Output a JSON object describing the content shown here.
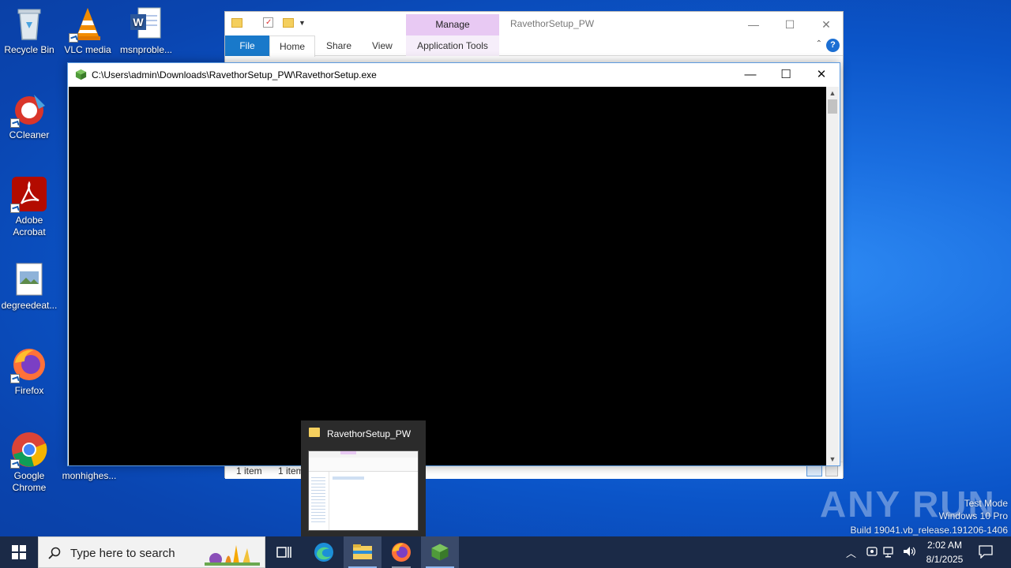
{
  "desktop": {
    "icons": [
      {
        "label": "Recycle Bin",
        "icon": "recycle-bin-icon"
      },
      {
        "label": "VLC media",
        "icon": "vlc-icon"
      },
      {
        "label": "msnproble...",
        "icon": "word-document-icon"
      },
      {
        "label": "CCleaner",
        "icon": "ccleaner-icon"
      },
      {
        "label": "Adobe Acrobat",
        "icon": "acrobat-icon"
      },
      {
        "label": "degreedeat...",
        "icon": "image-file-icon"
      },
      {
        "label": "Firefox",
        "icon": "firefox-icon"
      },
      {
        "label": "Google Chrome",
        "icon": "chrome-icon"
      },
      {
        "label": "monhighes...",
        "icon": "file-icon"
      }
    ]
  },
  "explorer": {
    "context_tab": "Manage",
    "title": "RavethorSetup_PW",
    "tabs": {
      "file": "File",
      "home": "Home",
      "share": "Share",
      "view": "View",
      "app_tools": "Application Tools"
    },
    "status_left": "1 item",
    "status_right": "1 item"
  },
  "console": {
    "title": "C:\\Users\\admin\\Downloads\\RavethorSetup_PW\\RavethorSetup.exe"
  },
  "preview": {
    "title": "RavethorSetup_PW"
  },
  "watermark": {
    "brand": "ANY RUN",
    "mode": "Test Mode",
    "edition": "Windows 10 Pro",
    "build": "Build 19041.vb_release.191206-1406"
  },
  "taskbar": {
    "search_placeholder": "Type here to search",
    "time": "2:02 AM",
    "date": "8/1/2025"
  },
  "colors": {
    "accent": "#1979ca",
    "manage_tab": "#e8c9f3",
    "taskbar": "#1b2a47"
  }
}
